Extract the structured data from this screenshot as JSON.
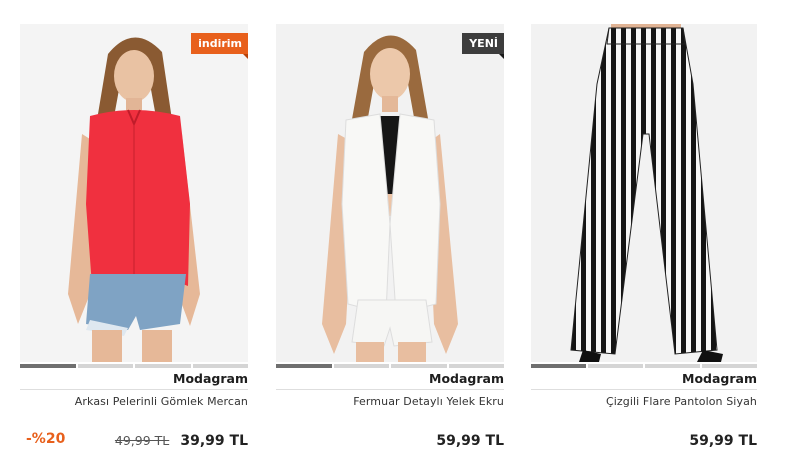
{
  "products": [
    {
      "badge": "indirim",
      "badge_color": "#e8601c",
      "brand": "Modagram",
      "name": "Arkası Pelerinli Gömlek Mercan",
      "discount": "-%20",
      "old_price": "49,99 TL",
      "price": "39,99 TL",
      "gallery_active_index": 1,
      "gallery_count": 4
    },
    {
      "badge": "YENİ",
      "badge_color": "#3d3d3d",
      "brand": "Modagram",
      "name": "Fermuar Detaylı Yelek Ekru",
      "price": "59,99 TL",
      "gallery_active_index": 1,
      "gallery_count": 4
    },
    {
      "brand": "Modagram",
      "name": "Çizgili Flare Pantolon Siyah",
      "price": "59,99 TL",
      "gallery_active_index": 1,
      "gallery_count": 4
    }
  ],
  "colors": {
    "accent": "#e8601c",
    "badge_dark": "#3d3d3d"
  }
}
